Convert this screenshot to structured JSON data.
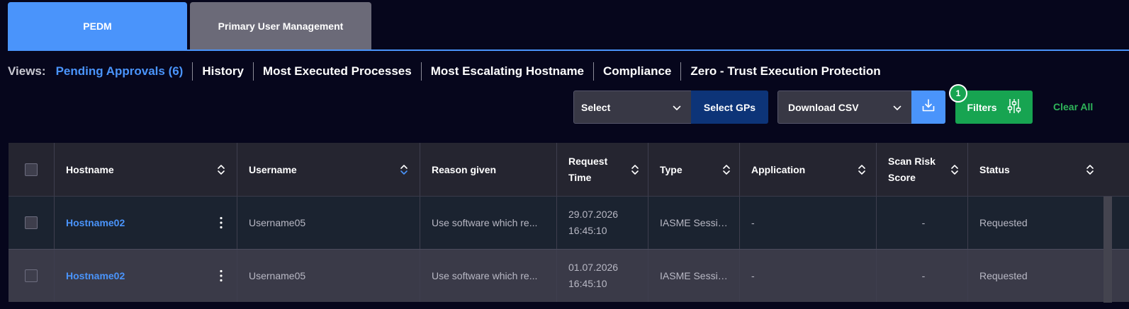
{
  "tabs": [
    {
      "label": "PEDM",
      "active": true
    },
    {
      "label": "Primary User Management",
      "active": false
    }
  ],
  "views": {
    "label": "Views:",
    "items": [
      "Pending Approvals (6)",
      "History",
      "Most Executed Processes",
      "Most Escalating Hostname",
      "Compliance",
      "Zero - Trust Execution Protection"
    ]
  },
  "toolbar": {
    "gp_select_value": "Select",
    "select_gps_label": "Select GPs",
    "csv_select_value": "Download CSV",
    "filters_label": "Filters",
    "filters_badge": "1",
    "clear_all_label": "Clear All"
  },
  "table": {
    "headers": [
      "Hostname",
      "Username",
      "Reason given",
      "Request Time",
      "Type",
      "Application",
      "Scan Risk Score",
      "Status"
    ],
    "header_lines": {
      "request_time": [
        "Request",
        "Time"
      ],
      "scan_risk": [
        "Scan Risk",
        "Score"
      ]
    },
    "rows": [
      {
        "hostname": "Hostname02",
        "username": "Username05",
        "reason": "Use software which re...",
        "date": "29.07.2026",
        "time": "16:45:10",
        "type": "IASME Sessio...",
        "application": "-",
        "risk": "-",
        "status": "Requested"
      },
      {
        "hostname": "Hostname02",
        "username": "Username05",
        "reason": "Use software which re...",
        "date": "01.07.2026",
        "time": "16:45:10",
        "type": "IASME Sessio...",
        "application": "-",
        "risk": "-",
        "status": "Requested"
      }
    ]
  },
  "colors": {
    "accent": "#4a94fb",
    "success": "#17a451",
    "background": "#06061c"
  }
}
